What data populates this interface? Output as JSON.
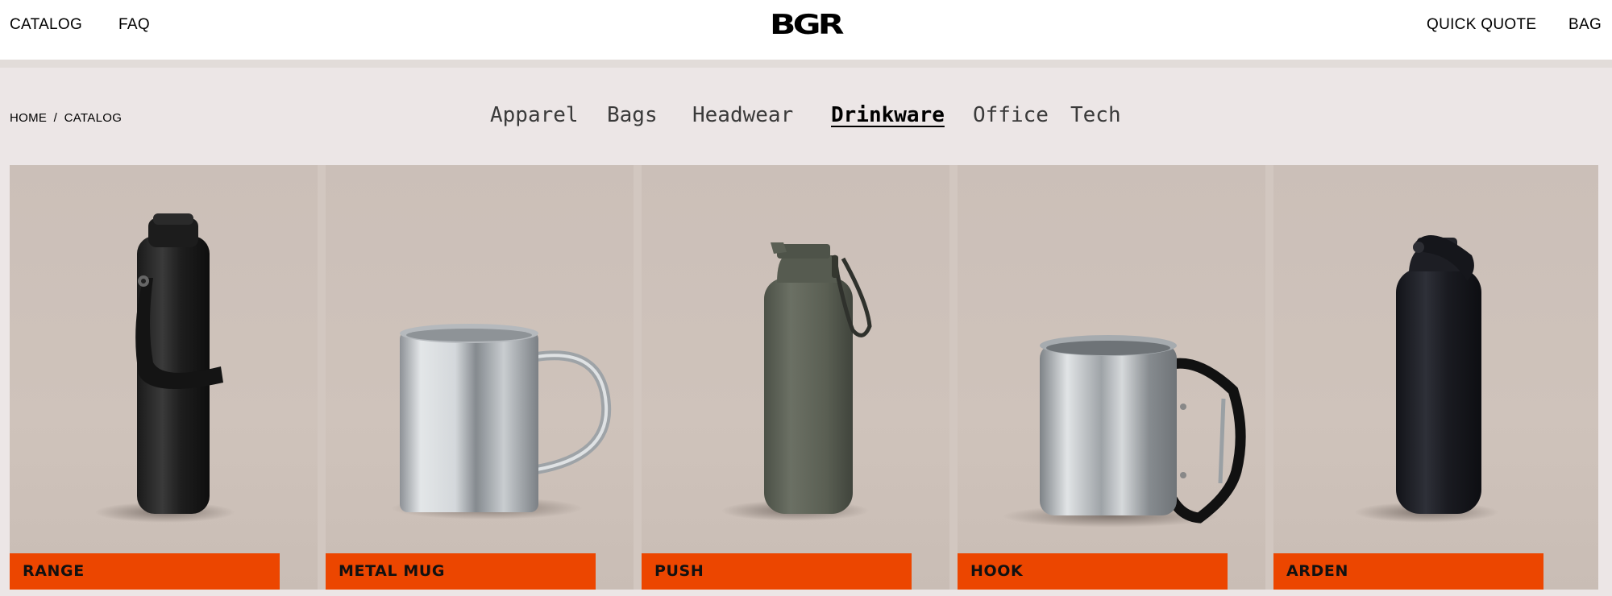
{
  "header": {
    "left_links": [
      "CATALOG",
      "FAQ"
    ],
    "logo": "BGR",
    "right_links": [
      "QUICK QUOTE",
      "BAG"
    ]
  },
  "breadcrumb": {
    "home": "HOME",
    "separator": "/",
    "current": "CATALOG"
  },
  "categories": {
    "items": [
      "Apparel",
      "Bags",
      "Headwear",
      "Drinkware",
      "Office",
      "Tech"
    ],
    "active": "Drinkware"
  },
  "products": [
    {
      "name": "RANGE",
      "icon": "black-bottle-with-strap"
    },
    {
      "name": "METAL MUG",
      "icon": "steel-mug"
    },
    {
      "name": "PUSH",
      "icon": "olive-bottle-with-loop"
    },
    {
      "name": "HOOK",
      "icon": "steel-mug-carabiner"
    },
    {
      "name": "ARDEN",
      "icon": "black-bottle-with-handle"
    }
  ],
  "colors": {
    "accent": "#ec4600",
    "header_bg": "#ffffff",
    "page_bg": "#ece6e6",
    "card_bg": "#cdc1b9"
  }
}
